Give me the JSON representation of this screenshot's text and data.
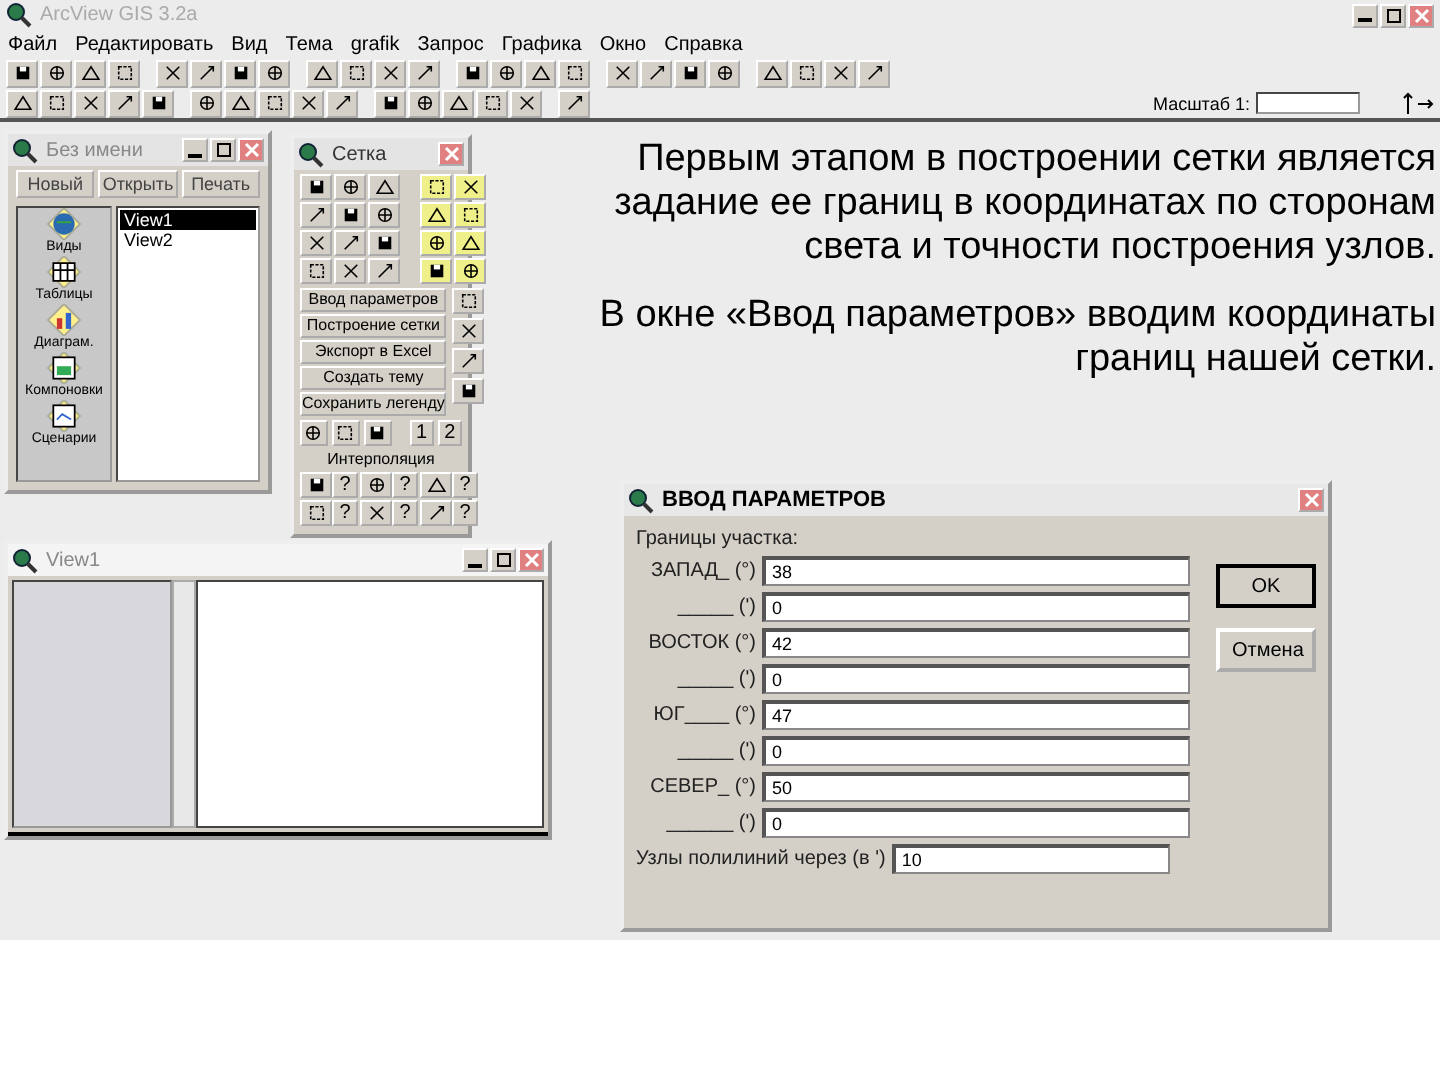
{
  "app": {
    "title": "ArcView GIS 3.2a",
    "menu": [
      "Файл",
      "Редактировать",
      "Вид",
      "Тема",
      "grafik",
      "Запрос",
      "Графика",
      "Окно",
      "Справка"
    ],
    "scale_label": "Масштаб 1:"
  },
  "project": {
    "title": "Без имени",
    "buttons": [
      "Новый",
      "Открыть",
      "Печать"
    ],
    "categories": [
      "Виды",
      "Таблицы",
      "Диаграм.",
      "Компоновки",
      "Сценарии"
    ],
    "docs": [
      {
        "label": "View1",
        "selected": true
      },
      {
        "label": "View2",
        "selected": false
      }
    ]
  },
  "palette": {
    "title": "Сетка",
    "buttons": [
      "Ввод параметров",
      "Построение сетки",
      "Экспорт в Excel",
      "Создать тему",
      "Сохранить легенду"
    ],
    "numbers": [
      "1",
      "2"
    ],
    "section": "Интерполяция",
    "help_marks": [
      "?",
      "?",
      "?",
      "?",
      "?",
      "?"
    ]
  },
  "view": {
    "title": "View1"
  },
  "dialog": {
    "title": "ВВОД ПАРАМЕТРОВ",
    "group": "Границы участка:",
    "fields": [
      {
        "label": "ЗАПАД_ (°)",
        "value": "38"
      },
      {
        "label": "_____ (')",
        "value": "0"
      },
      {
        "label": "ВОСТОК (°)",
        "value": "42"
      },
      {
        "label": "_____ (')",
        "value": "0"
      },
      {
        "label": "ЮГ____ (°)",
        "value": "47"
      },
      {
        "label": "_____ (')",
        "value": "0"
      },
      {
        "label": "СЕВЕР_ (°)",
        "value": "50"
      },
      {
        "label": "______ (')",
        "value": "0"
      }
    ],
    "nodes": {
      "label": "Узлы полилиний через (в ')",
      "value": "10"
    },
    "buttons": [
      "OK",
      "Отмена"
    ]
  },
  "slide": {
    "paragraphs": [
      "Первым этапом в построении сетки является задание ее границ в координатах по сторонам света и точности построения узлов.",
      "В окне «Ввод параметров» вводим координаты границ нашей сетки."
    ]
  }
}
